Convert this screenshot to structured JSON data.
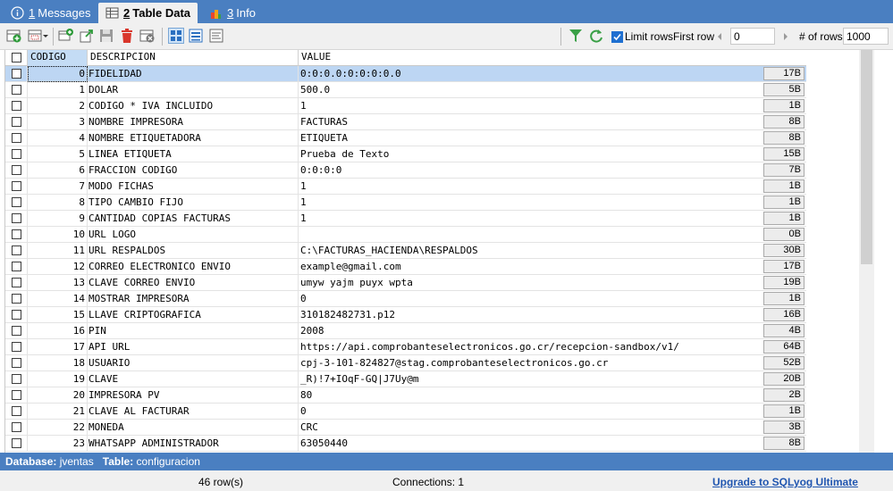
{
  "tabs": [
    {
      "num": "1",
      "label": " Messages",
      "icon": "info-icon"
    },
    {
      "num": "2",
      "label": " Table Data",
      "icon": "table-icon",
      "active": true
    },
    {
      "num": "3",
      "label": " Info",
      "icon": "chart-icon"
    }
  ],
  "toolbar": {
    "limit_rows_label": "Limit rows",
    "first_row_label": "First row",
    "first_row_value": "0",
    "num_rows_label": "# of rows",
    "num_rows_value": "1000",
    "limit_rows_checked": true
  },
  "grid": {
    "columns": [
      "CODIGO",
      "DESCRIPCION",
      "VALUE"
    ],
    "rows": [
      {
        "codigo": "0",
        "descripcion": "FIDELIDAD",
        "value": "0:0:0.0:0:0:0:0.0",
        "size": "17B"
      },
      {
        "codigo": "1",
        "descripcion": "DOLAR",
        "value": "500.0",
        "size": "5B"
      },
      {
        "codigo": "2",
        "descripcion": "CODIGO * IVA INCLUIDO",
        "value": "1",
        "size": "1B"
      },
      {
        "codigo": "3",
        "descripcion": "NOMBRE IMPRESORA",
        "value": "FACTURAS",
        "size": "8B"
      },
      {
        "codigo": "4",
        "descripcion": "NOMBRE ETIQUETADORA",
        "value": "ETIQUETA",
        "size": "8B"
      },
      {
        "codigo": "5",
        "descripcion": "LINEA ETIQUETA",
        "value": "Prueba de Texto",
        "size": "15B"
      },
      {
        "codigo": "6",
        "descripcion": "FRACCION CODIGO",
        "value": "0:0:0:0",
        "size": "7B"
      },
      {
        "codigo": "7",
        "descripcion": "MODO FICHAS",
        "value": "1",
        "size": "1B"
      },
      {
        "codigo": "8",
        "descripcion": "TIPO CAMBIO FIJO",
        "value": "1",
        "size": "1B"
      },
      {
        "codigo": "9",
        "descripcion": "CANTIDAD COPIAS FACTURAS",
        "value": "1",
        "size": "1B"
      },
      {
        "codigo": "10",
        "descripcion": "URL LOGO",
        "value": "",
        "size": "0B"
      },
      {
        "codigo": "11",
        "descripcion": "URL RESPALDOS",
        "value": "C:\\FACTURAS_HACIENDA\\RESPALDOS",
        "size": "30B"
      },
      {
        "codigo": "12",
        "descripcion": "CORREO ELECTRONICO ENVIO",
        "value": "example@gmail.com",
        "size": "17B"
      },
      {
        "codigo": "13",
        "descripcion": "CLAVE CORREO ENVIO",
        "value": "umyw yajm puyx wpta",
        "size": "19B"
      },
      {
        "codigo": "14",
        "descripcion": "MOSTRAR IMPRESORA",
        "value": "0",
        "size": "1B"
      },
      {
        "codigo": "15",
        "descripcion": "LLAVE CRIPTOGRAFICA",
        "value": "310182482731.p12",
        "size": "16B"
      },
      {
        "codigo": "16",
        "descripcion": "PIN",
        "value": "2008",
        "size": "4B"
      },
      {
        "codigo": "17",
        "descripcion": "API URL",
        "value": "https://api.comprobanteselectronicos.go.cr/recepcion-sandbox/v1/",
        "size": "64B"
      },
      {
        "codigo": "18",
        "descripcion": "USUARIO",
        "value": "cpj-3-101-824827@stag.comprobanteselectronicos.go.cr",
        "size": "52B"
      },
      {
        "codigo": "19",
        "descripcion": "CLAVE",
        "value": "_R)!7+IOqF-GQ|J7Uy@m",
        "size": "20B"
      },
      {
        "codigo": "20",
        "descripcion": "IMPRESORA PV",
        "value": "80",
        "size": "2B"
      },
      {
        "codigo": "21",
        "descripcion": "CLAVE AL FACTURAR",
        "value": "0",
        "size": "1B"
      },
      {
        "codigo": "22",
        "descripcion": "MONEDA",
        "value": "CRC",
        "size": "3B"
      },
      {
        "codigo": "23",
        "descripcion": "WHATSAPP ADMINISTRADOR",
        "value": "63050440",
        "size": "8B"
      }
    ]
  },
  "status": {
    "database_label": "Database:",
    "database_value": "jventas",
    "table_label": "Table:",
    "table_value": "configuracion",
    "row_count": "46 row(s)",
    "connections": "Connections: 1",
    "upgrade": "Upgrade to SQLyog Ultimate"
  },
  "colors": {
    "accent": "#4a7fc1",
    "selected_row": "#bdd6f3"
  }
}
